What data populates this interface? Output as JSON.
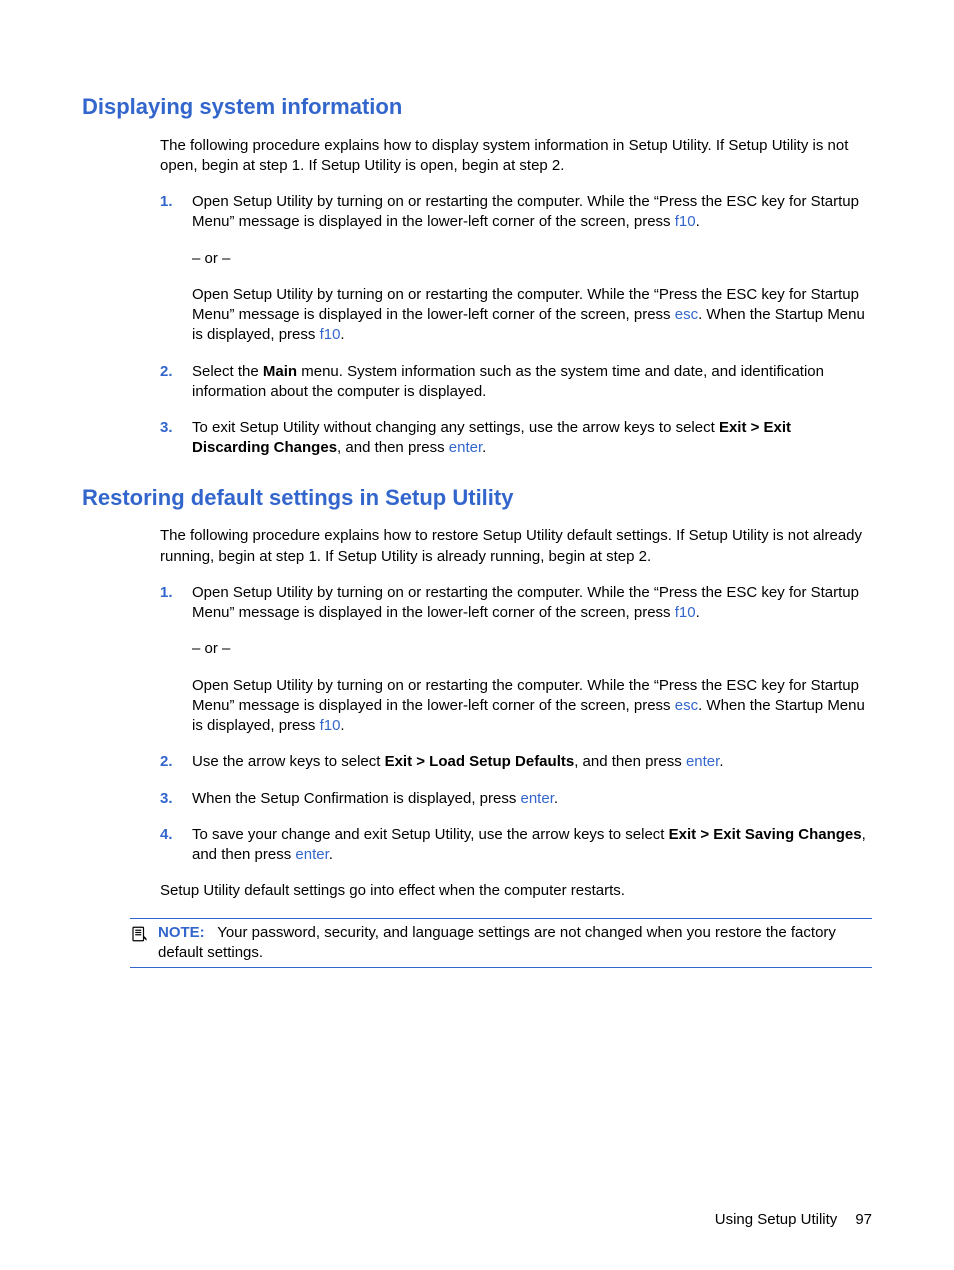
{
  "section1": {
    "heading": "Displaying system information",
    "intro": "The following procedure explains how to display system information in Setup Utility. If Setup Utility is not open, begin at step 1. If Setup Utility is open, begin at step 2.",
    "steps": [
      {
        "num": "1.",
        "p1a": "Open Setup Utility by turning on or restarting the computer. While the “Press the ESC key for Startup Menu” message is displayed in the lower-left corner of the screen, press ",
        "p1key": "f10",
        "p1b": ".",
        "or": "– or –",
        "p2a": "Open Setup Utility by turning on or restarting the computer. While the “Press the ESC key for Startup Menu” message is displayed in the lower-left corner of the screen, press ",
        "p2key1": "esc",
        "p2b": ". When the Startup Menu is displayed, press ",
        "p2key2": "f10",
        "p2c": "."
      },
      {
        "num": "2.",
        "a": "Select the ",
        "bold": "Main",
        "b": " menu. System information such as the system time and date, and identification information about the computer is displayed."
      },
      {
        "num": "3.",
        "a": "To exit Setup Utility without changing any settings, use the arrow keys to select ",
        "bold": "Exit > Exit Discarding Changes",
        "b": ", and then press ",
        "key": "enter",
        "c": "."
      }
    ]
  },
  "section2": {
    "heading": "Restoring default settings in Setup Utility",
    "intro": "The following procedure explains how to restore Setup Utility default settings. If Setup Utility is not already running, begin at step 1. If Setup Utility is already running, begin at step 2.",
    "steps": [
      {
        "num": "1.",
        "p1a": "Open Setup Utility by turning on or restarting the computer. While the “Press the ESC key for Startup Menu” message is displayed in the lower-left corner of the screen, press ",
        "p1key": "f10",
        "p1b": ".",
        "or": "– or –",
        "p2a": "Open Setup Utility by turning on or restarting the computer. While the “Press the ESC key for Startup Menu” message is displayed in the lower-left corner of the screen, press ",
        "p2key1": "esc",
        "p2b": ". When the Startup Menu is displayed, press ",
        "p2key2": "f10",
        "p2c": "."
      },
      {
        "num": "2.",
        "a": "Use the arrow keys to select ",
        "bold": "Exit > Load Setup Defaults",
        "b": ", and then press ",
        "key": "enter",
        "c": "."
      },
      {
        "num": "3.",
        "a": "When the Setup Confirmation is displayed, press ",
        "key": "enter",
        "b": "."
      },
      {
        "num": "4.",
        "a": "To save your change and exit Setup Utility, use the arrow keys to select ",
        "bold": "Exit > Exit Saving Changes",
        "b": ", and then press ",
        "key": "enter",
        "c": "."
      }
    ],
    "outro": "Setup Utility default settings go into effect when the computer restarts.",
    "note_label": "NOTE:",
    "note_text": "Your password, security, and language settings are not changed when you restore the factory default settings."
  },
  "footer": {
    "section": "Using Setup Utility",
    "page": "97"
  }
}
